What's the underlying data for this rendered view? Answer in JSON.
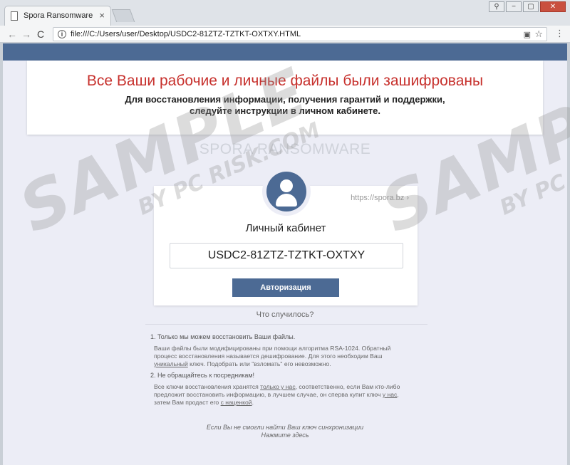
{
  "browser": {
    "tab_title": "Spora Ransomware",
    "tab_close": "×",
    "url": "file:///C:/Users/user/Desktop/USDC2-81ZTZ-TZTKT-OXTXY.HTML",
    "back": "←",
    "forward": "→",
    "reload": "C",
    "window_minimize": "−",
    "window_maximize": "▢",
    "window_close": "✕",
    "window_user": "⚲"
  },
  "alert": {
    "title": "Все Ваши рабочие и личные файлы были зашифрованы",
    "subtitle_line1": "Для восстановления информации, получения гарантий и поддержки,",
    "subtitle_line2": "следуйте инструкции в личном кабинете."
  },
  "brand": "SPORA RANSOMWARE",
  "card": {
    "link": "https://spora.bz ›",
    "title": "Личный кабинет",
    "key": "USDC2-81ZTZ-TZTKT-OXTXY",
    "button": "Авторизация"
  },
  "what_happened": "Что случилось?",
  "info": {
    "point1": "1. Только мы можем восстановить Ваши файлы.",
    "p1_line1": "Ваши файлы были модифицированы при помощи алгоритма RSA-1024. Обратный",
    "p1_line2": "процесс восстановления называется дешифрование. Для этого необходим Ваш",
    "p1_underline": "уникальный",
    "p1_line3": " ключ. Подобрать или \"взломать\" его невозможно.",
    "point2": "2. Не обращайтесь к посредникам!",
    "p2_a": "Все ключи восстановления хранятся ",
    "p2_u1": "только у нас",
    "p2_b": ", соответственно, если Вам кто-либо",
    "p2_line2_a": "предложит восстановить информацию, в лучшем случае, он сперва купит ключ ",
    "p2_u2": "у нас",
    "p2_line2_b": ",",
    "p2_line3_a": "затем Вам продаст его ",
    "p2_u3": "с наценкой",
    "p2_line3_b": "."
  },
  "bottom": {
    "line1": "Если Вы не смогли найти Ваш ключ синхронизации",
    "line2": "Нажмите здесь"
  },
  "watermark": {
    "big": "SAMPLE",
    "small": "BY PC RISK.COM"
  }
}
